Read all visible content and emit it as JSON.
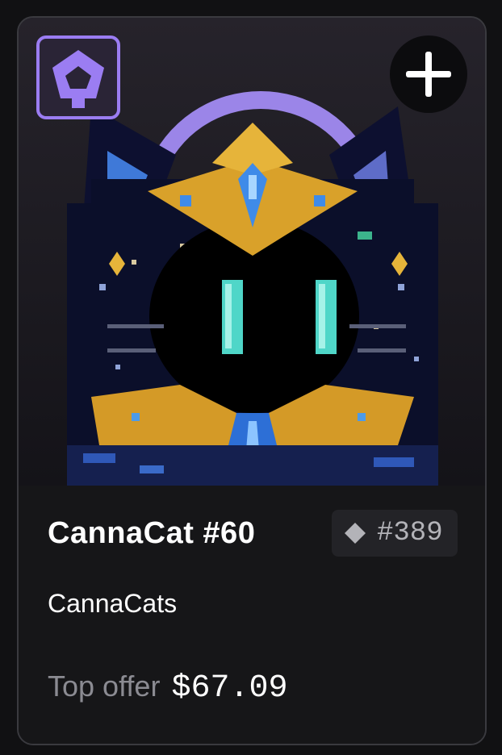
{
  "card": {
    "title": "CannaCat #60",
    "rank": "#389",
    "collection": "CannaCats",
    "offer_label": "Top offer",
    "offer_price": "$67.09"
  },
  "icons": {
    "chain": "pentagon-chain-icon",
    "add": "plus-icon",
    "rank": "diamond-icon"
  },
  "colors": {
    "accent": "#9b7df2",
    "background": "#111113",
    "card": "#161618",
    "badge": "#232327",
    "muted_text": "#8b8b92"
  }
}
